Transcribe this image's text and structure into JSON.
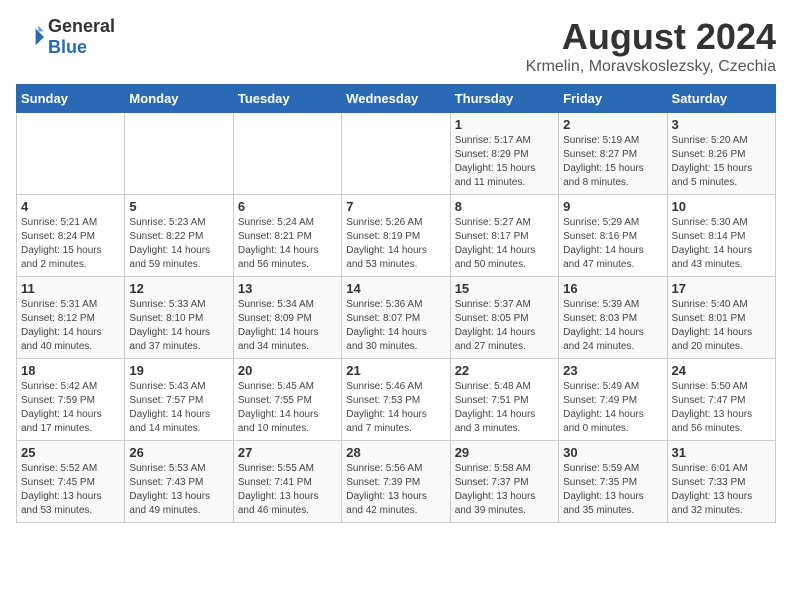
{
  "logo": {
    "text_general": "General",
    "text_blue": "Blue"
  },
  "title": "August 2024",
  "subtitle": "Krmelin, Moravskoslezsky, Czechia",
  "days_of_week": [
    "Sunday",
    "Monday",
    "Tuesday",
    "Wednesday",
    "Thursday",
    "Friday",
    "Saturday"
  ],
  "weeks": [
    [
      {
        "day": "",
        "info": ""
      },
      {
        "day": "",
        "info": ""
      },
      {
        "day": "",
        "info": ""
      },
      {
        "day": "",
        "info": ""
      },
      {
        "day": "1",
        "info": "Sunrise: 5:17 AM\nSunset: 8:29 PM\nDaylight: 15 hours\nand 11 minutes."
      },
      {
        "day": "2",
        "info": "Sunrise: 5:19 AM\nSunset: 8:27 PM\nDaylight: 15 hours\nand 8 minutes."
      },
      {
        "day": "3",
        "info": "Sunrise: 5:20 AM\nSunset: 8:26 PM\nDaylight: 15 hours\nand 5 minutes."
      }
    ],
    [
      {
        "day": "4",
        "info": "Sunrise: 5:21 AM\nSunset: 8:24 PM\nDaylight: 15 hours\nand 2 minutes."
      },
      {
        "day": "5",
        "info": "Sunrise: 5:23 AM\nSunset: 8:22 PM\nDaylight: 14 hours\nand 59 minutes."
      },
      {
        "day": "6",
        "info": "Sunrise: 5:24 AM\nSunset: 8:21 PM\nDaylight: 14 hours\nand 56 minutes."
      },
      {
        "day": "7",
        "info": "Sunrise: 5:26 AM\nSunset: 8:19 PM\nDaylight: 14 hours\nand 53 minutes."
      },
      {
        "day": "8",
        "info": "Sunrise: 5:27 AM\nSunset: 8:17 PM\nDaylight: 14 hours\nand 50 minutes."
      },
      {
        "day": "9",
        "info": "Sunrise: 5:29 AM\nSunset: 8:16 PM\nDaylight: 14 hours\nand 47 minutes."
      },
      {
        "day": "10",
        "info": "Sunrise: 5:30 AM\nSunset: 8:14 PM\nDaylight: 14 hours\nand 43 minutes."
      }
    ],
    [
      {
        "day": "11",
        "info": "Sunrise: 5:31 AM\nSunset: 8:12 PM\nDaylight: 14 hours\nand 40 minutes."
      },
      {
        "day": "12",
        "info": "Sunrise: 5:33 AM\nSunset: 8:10 PM\nDaylight: 14 hours\nand 37 minutes."
      },
      {
        "day": "13",
        "info": "Sunrise: 5:34 AM\nSunset: 8:09 PM\nDaylight: 14 hours\nand 34 minutes."
      },
      {
        "day": "14",
        "info": "Sunrise: 5:36 AM\nSunset: 8:07 PM\nDaylight: 14 hours\nand 30 minutes."
      },
      {
        "day": "15",
        "info": "Sunrise: 5:37 AM\nSunset: 8:05 PM\nDaylight: 14 hours\nand 27 minutes."
      },
      {
        "day": "16",
        "info": "Sunrise: 5:39 AM\nSunset: 8:03 PM\nDaylight: 14 hours\nand 24 minutes."
      },
      {
        "day": "17",
        "info": "Sunrise: 5:40 AM\nSunset: 8:01 PM\nDaylight: 14 hours\nand 20 minutes."
      }
    ],
    [
      {
        "day": "18",
        "info": "Sunrise: 5:42 AM\nSunset: 7:59 PM\nDaylight: 14 hours\nand 17 minutes."
      },
      {
        "day": "19",
        "info": "Sunrise: 5:43 AM\nSunset: 7:57 PM\nDaylight: 14 hours\nand 14 minutes."
      },
      {
        "day": "20",
        "info": "Sunrise: 5:45 AM\nSunset: 7:55 PM\nDaylight: 14 hours\nand 10 minutes."
      },
      {
        "day": "21",
        "info": "Sunrise: 5:46 AM\nSunset: 7:53 PM\nDaylight: 14 hours\nand 7 minutes."
      },
      {
        "day": "22",
        "info": "Sunrise: 5:48 AM\nSunset: 7:51 PM\nDaylight: 14 hours\nand 3 minutes."
      },
      {
        "day": "23",
        "info": "Sunrise: 5:49 AM\nSunset: 7:49 PM\nDaylight: 14 hours\nand 0 minutes."
      },
      {
        "day": "24",
        "info": "Sunrise: 5:50 AM\nSunset: 7:47 PM\nDaylight: 13 hours\nand 56 minutes."
      }
    ],
    [
      {
        "day": "25",
        "info": "Sunrise: 5:52 AM\nSunset: 7:45 PM\nDaylight: 13 hours\nand 53 minutes."
      },
      {
        "day": "26",
        "info": "Sunrise: 5:53 AM\nSunset: 7:43 PM\nDaylight: 13 hours\nand 49 minutes."
      },
      {
        "day": "27",
        "info": "Sunrise: 5:55 AM\nSunset: 7:41 PM\nDaylight: 13 hours\nand 46 minutes."
      },
      {
        "day": "28",
        "info": "Sunrise: 5:56 AM\nSunset: 7:39 PM\nDaylight: 13 hours\nand 42 minutes."
      },
      {
        "day": "29",
        "info": "Sunrise: 5:58 AM\nSunset: 7:37 PM\nDaylight: 13 hours\nand 39 minutes."
      },
      {
        "day": "30",
        "info": "Sunrise: 5:59 AM\nSunset: 7:35 PM\nDaylight: 13 hours\nand 35 minutes."
      },
      {
        "day": "31",
        "info": "Sunrise: 6:01 AM\nSunset: 7:33 PM\nDaylight: 13 hours\nand 32 minutes."
      }
    ]
  ]
}
